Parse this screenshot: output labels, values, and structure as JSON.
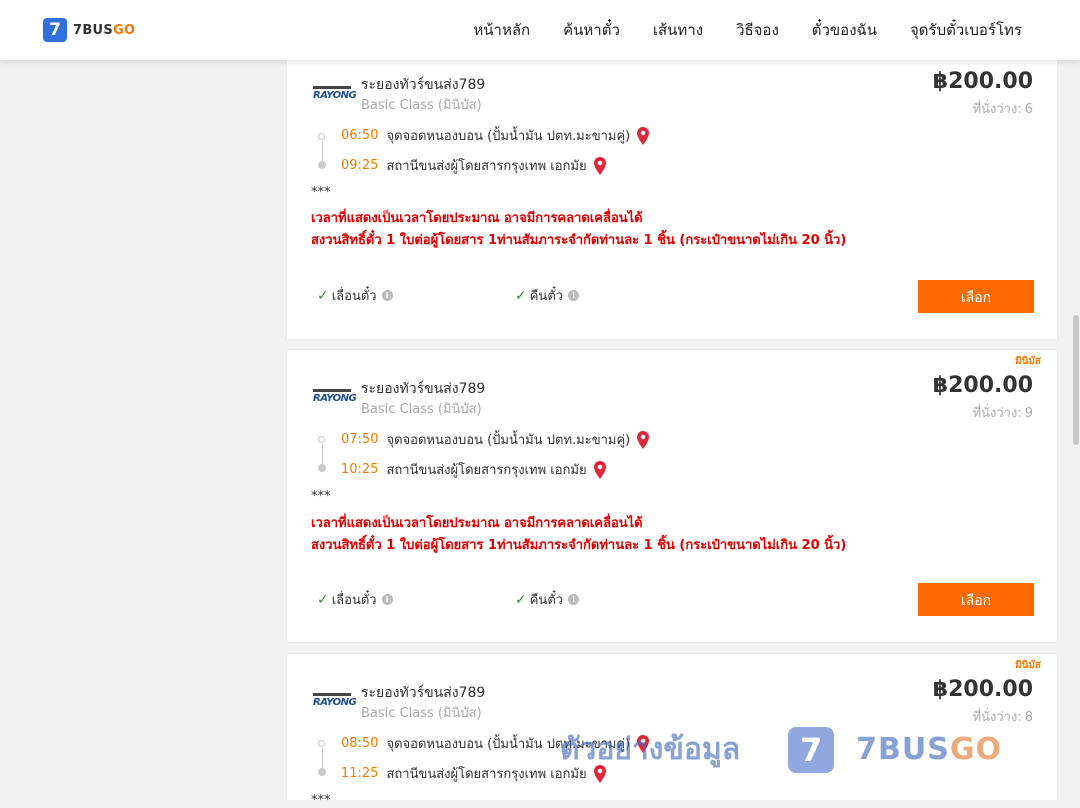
{
  "brand": {
    "logo_digit": "7",
    "name_main": "7BUS",
    "name_accent": "GO"
  },
  "nav": [
    {
      "label": "หน้าหลัก"
    },
    {
      "label": "ค้นหาตั๋ว"
    },
    {
      "label": "เส้นทาง"
    },
    {
      "label": "วิธีจอง"
    },
    {
      "label": "ตั๋วของฉัน"
    },
    {
      "label": "จุดรับตั๋วเบอร์โทร"
    }
  ],
  "cards": [
    {
      "badge": "",
      "operator_logo_text": "RAYONG",
      "operator": "ระยองทัวร์ขนส่ง789",
      "class": "Basic Class (มินิบัส)",
      "price": "฿200.00",
      "seats_label": "ที่นั่งว่าง:",
      "seats": "6",
      "depart_time": "06:50",
      "depart_place": "จุดจอดหนองบอน (ปั้มน้ำมัน ปตท.มะขามคู่)",
      "arrive_time": "09:25",
      "arrive_place": "สถานีขนส่งผู้โดยสารกรุงเทพ เอกมัย",
      "stars": "***",
      "note1": "เวลาที่แสดงเป็นเวลาโดยประมาณ อาจมีการคลาดเคลื่อนได้",
      "note2": "สงวนสิทธิ์ตั๋ว 1 ใบต่อผู้โดยสาร 1ท่านสัมภาระจำกัดท่านละ 1 ชิ้น (กระเป๋าขนาดไม่เกิน 20 นิ้ว)",
      "feature_change": "เลื่อนตั๋ว",
      "feature_refund": "คืนตั๋ว",
      "button": "เลือก"
    },
    {
      "badge": "มินิบัส",
      "operator_logo_text": "RAYONG",
      "operator": "ระยองทัวร์ขนส่ง789",
      "class": "Basic Class (มินิบัส)",
      "price": "฿200.00",
      "seats_label": "ที่นั่งว่าง:",
      "seats": "9",
      "depart_time": "07:50",
      "depart_place": "จุดจอดหนองบอน (ปั้มน้ำมัน ปตท.มะขามคู่)",
      "arrive_time": "10:25",
      "arrive_place": "สถานีขนส่งผู้โดยสารกรุงเทพ เอกมัย",
      "stars": "***",
      "note1": "เวลาที่แสดงเป็นเวลาโดยประมาณ อาจมีการคลาดเคลื่อนได้",
      "note2": "สงวนสิทธิ์ตั๋ว 1 ใบต่อผู้โดยสาร 1ท่านสัมภาระจำกัดท่านละ 1 ชิ้น (กระเป๋าขนาดไม่เกิน 20 นิ้ว)",
      "feature_change": "เลื่อนตั๋ว",
      "feature_refund": "คืนตั๋ว",
      "button": "เลือก"
    },
    {
      "badge": "มินิบัส",
      "operator_logo_text": "RAYONG",
      "operator": "ระยองทัวร์ขนส่ง789",
      "class": "Basic Class (มินิบัส)",
      "price": "฿200.00",
      "seats_label": "ที่นั่งว่าง:",
      "seats": "8",
      "depart_time": "08:50",
      "depart_place": "จุดจอดหนองบอน (ปั้มน้ำมัน ปตท.มะขามคู่)",
      "arrive_time": "11:25",
      "arrive_place": "สถานีขนส่งผู้โดยสารกรุงเทพ เอกมัย",
      "stars": "***"
    }
  ],
  "watermark": {
    "text": "ตัวอย่างข้อมูล",
    "digit": "7",
    "brand_main": "7BUS",
    "brand_accent": "GO"
  },
  "colors": {
    "accent": "#f07a00",
    "button": "#ff6a00",
    "warning": "#e00000",
    "logo": "#2f6fe0"
  }
}
